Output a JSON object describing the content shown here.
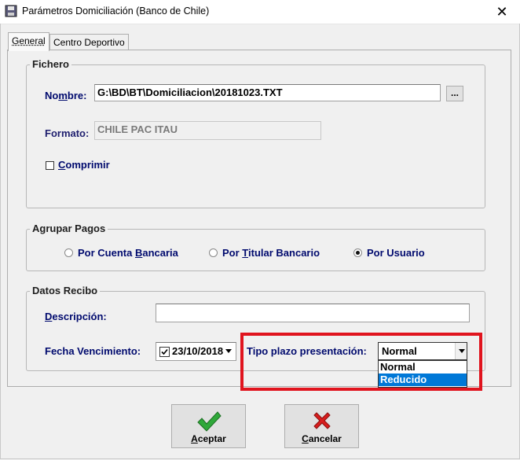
{
  "window": {
    "title": "Parámetros Domiciliación (Banco de Chile)",
    "close_glyph": "✕"
  },
  "tabs": [
    {
      "label": "General"
    },
    {
      "label": "Centro Deportivo"
    }
  ],
  "fichero": {
    "legend": "Fichero",
    "nombre_label_pre": "No",
    "nombre_label_u": "m",
    "nombre_label_post": "bre:",
    "nombre_value": "G:\\BD\\BT\\Domiciliacion\\20181023.TXT",
    "browse_label": "...",
    "formato_label": "Formato:",
    "formato_value": "CHILE PAC ITAU",
    "comprimir_label_u": "C",
    "comprimir_label_post": "omprimir"
  },
  "agrupar": {
    "legend": "Agrupar Pagos",
    "options": [
      {
        "pre": "Por Cuenta ",
        "u": "B",
        "post": "ancaria",
        "checked": false
      },
      {
        "pre": "Por ",
        "u": "T",
        "post": "itular Bancario",
        "checked": false
      },
      {
        "pre": "Por Usuario",
        "u": "",
        "post": "",
        "checked": true
      }
    ]
  },
  "recibo": {
    "legend": "Datos Recibo",
    "descripcion_label_u": "D",
    "descripcion_label_post": "escripción:",
    "descripcion_value": "",
    "fecha_label": "Fecha Vencimiento:",
    "fecha_value": "23/10/2018",
    "fecha_checked": true,
    "tipo_label": "Tipo plazo presentación:",
    "tipo_value": "Normal",
    "tipo_options": [
      "Normal",
      "Reducido"
    ],
    "tipo_selected_option": "Reducido"
  },
  "buttons": {
    "aceptar_u": "A",
    "aceptar_post": "ceptar",
    "cancelar_u": "C",
    "cancelar_post": "ancelar"
  },
  "colors": {
    "highlight": "#e0141e",
    "label_blue": "#000a6e",
    "selection": "#0078d7"
  }
}
